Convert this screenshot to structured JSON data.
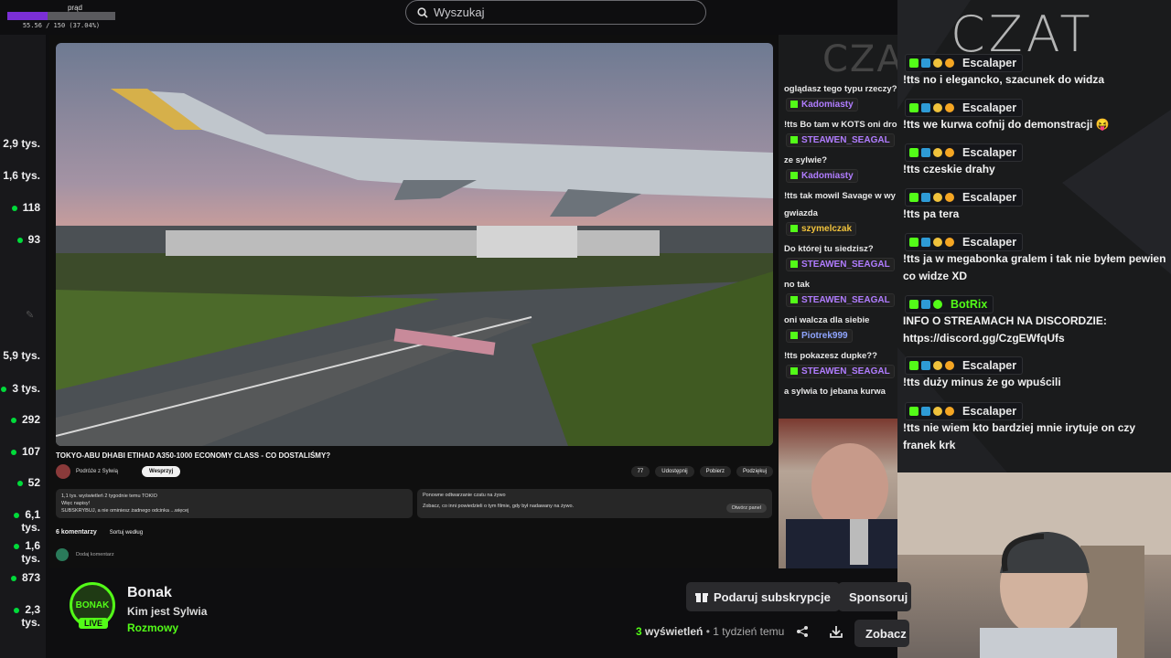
{
  "overlay": {
    "label": "prąd",
    "value_text": "55.56 / 150 (37.04%)",
    "fraction": 0.3704
  },
  "search": {
    "placeholder": "Wyszukaj"
  },
  "rail": {
    "items": [
      {
        "text": "2,9 tys.",
        "live": false
      },
      {
        "text": "1,6 tys.",
        "live": false
      },
      {
        "text": "118",
        "live": true
      },
      {
        "text": "93",
        "live": true
      },
      {
        "text": "5,9 tys.",
        "live": false
      },
      {
        "text": "3 tys.",
        "live": true
      },
      {
        "text": "292",
        "live": true
      },
      {
        "text": "107",
        "live": true
      },
      {
        "text": "52",
        "live": true
      },
      {
        "text": "6,1 tys.",
        "live": true
      },
      {
        "text": "1,6 tys.",
        "live": true
      },
      {
        "text": "873",
        "live": true
      },
      {
        "text": "2,3 tys.",
        "live": true
      }
    ]
  },
  "youtube": {
    "title": "TOKYO-ABU DHABI ETIHAD A350-1000 ECONOMY CLASS - CO DOSTALIŚMY?",
    "channel": "Podróże z Sylwią",
    "support": "Wesprzyj",
    "actions": [
      "77",
      "Udostępnij",
      "Pobierz",
      "Podziękuj"
    ],
    "desc_line1": "1,1 tys. wyświetleń  2 tygodnie temu  TOKIO",
    "desc_line2": "Więc napisy!",
    "desc_line3": "SUBSKRYBUJ, a  nie ominiesz żadnego odcinka ...więcej",
    "replay_title": "Ponowne odtwarzanie czatu na żywo",
    "replay_text": "Zobacz, co inni powiedzieli o tym filmie, gdy był nadawany na żywo.",
    "replay_btn": "Otwórz panel",
    "comments": "6 komentarzy",
    "sort": "Sortuj według",
    "add_comment": "Dodaj komentarz"
  },
  "mini_chat": {
    "watermark": "CZA",
    "lines": [
      {
        "type": "text",
        "text": "oglądasz tego typu rzeczy?"
      },
      {
        "type": "name",
        "text": "Kadomiasty",
        "color": "#b07cff"
      },
      {
        "type": "text",
        "text": "!tts Bo tam w KOTS oni drol"
      },
      {
        "type": "name",
        "text": "STEAWEN_SEAGAL",
        "color": "#b07cff"
      },
      {
        "type": "text",
        "text": "ze sylwie?"
      },
      {
        "type": "name",
        "text": "Kadomiasty",
        "color": "#b07cff"
      },
      {
        "type": "text",
        "text": "!tts tak mowil Savage w wy"
      },
      {
        "type": "text",
        "text": "gwiazda"
      },
      {
        "type": "name",
        "text": "szymelczak",
        "color": "#f0c23c"
      },
      {
        "type": "text",
        "text": "Do której tu siedzisz?"
      },
      {
        "type": "name",
        "text": "STEAWEN_SEAGAL",
        "color": "#b07cff"
      },
      {
        "type": "text",
        "text": "no tak"
      },
      {
        "type": "name",
        "text": "STEAWEN_SEAGAL",
        "color": "#b07cff"
      },
      {
        "type": "text",
        "text": "oni walcza dla siebie"
      },
      {
        "type": "name",
        "text": "Piotrek999",
        "color": "#8fa5ff"
      },
      {
        "type": "text",
        "text": "!tts pokazesz dupke??"
      },
      {
        "type": "name",
        "text": "STEAWEN_SEAGAL",
        "color": "#b07cff"
      },
      {
        "type": "text",
        "text": "a sylwia to jebana kurwa"
      }
    ]
  },
  "chat": {
    "title": "CZAT",
    "messages": [
      {
        "user": "Escalaper",
        "text": "!tts no i elegancko, szacunek do widza"
      },
      {
        "user": "Escalaper",
        "text": "!tts we kurwa cofnij do demonstracji 😝"
      },
      {
        "user": "Escalaper",
        "text": "!tts czeskie drahy"
      },
      {
        "user": "Escalaper",
        "text": "!tts pa tera"
      },
      {
        "user": "Escalaper",
        "text": "!tts ja w megabonka gralem i tak nie byłem pewien co widze XD"
      },
      {
        "user": "BotRix",
        "text": "INFO O STREAMACH NA DISCORDZIE: https://discord.gg/CzgEWfqUfs"
      },
      {
        "user": "Escalaper",
        "text": "!tts duży minus że go wpuścili"
      },
      {
        "user": "Escalaper",
        "text": "!tts nie wiem kto bardziej mnie irytuje on czy franek krk"
      }
    ],
    "user_colors": {
      "Escalaper": "#e8e8e8",
      "BotRix": "#53fc18"
    }
  },
  "channel": {
    "avatar_text": "BONAK",
    "live": "LIVE",
    "name": "Bonak",
    "stream_title": "Kim jest Sylwia",
    "category": "Rozmowy",
    "gift_sub": "Podaruj subskrypcje",
    "sponsor": "Sponsoruj",
    "views_count": "3",
    "views_word": "wyświetleń",
    "views_time": "• 1 tydzień temu",
    "more": "Zobacz"
  },
  "colors": {
    "accent": "#53fc18",
    "bg": "#0e0e10"
  }
}
